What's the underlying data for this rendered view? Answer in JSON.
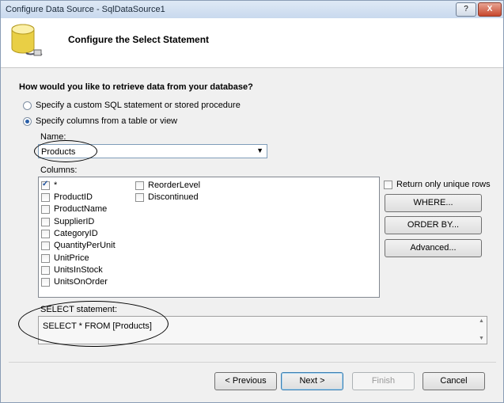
{
  "window": {
    "title": "Configure Data Source - SqlDataSource1",
    "help_label": "?",
    "close_label": "X"
  },
  "header": {
    "title": "Configure the Select Statement"
  },
  "retrieve": {
    "question": "How would you like to retrieve data from your database?",
    "option_custom": "Specify a custom SQL statement or stored procedure",
    "option_columns": "Specify columns from a table or view",
    "selected": "option_columns"
  },
  "name": {
    "label": "Name:",
    "value": "Products"
  },
  "columns": {
    "label": "Columns:",
    "items": [
      {
        "label": "*",
        "checked": true
      },
      {
        "label": "ProductID",
        "checked": false
      },
      {
        "label": "ProductName",
        "checked": false
      },
      {
        "label": "SupplierID",
        "checked": false
      },
      {
        "label": "CategoryID",
        "checked": false
      },
      {
        "label": "QuantityPerUnit",
        "checked": false
      },
      {
        "label": "UnitPrice",
        "checked": false
      },
      {
        "label": "UnitsInStock",
        "checked": false
      },
      {
        "label": "UnitsOnOrder",
        "checked": false
      },
      {
        "label": "ReorderLevel",
        "checked": false
      },
      {
        "label": "Discontinued",
        "checked": false
      }
    ]
  },
  "options": {
    "unique_rows_label": "Return only unique rows",
    "unique_rows_checked": false,
    "where_label": "WHERE...",
    "orderby_label": "ORDER BY...",
    "advanced_label": "Advanced..."
  },
  "sql": {
    "label": "SELECT statement:",
    "value": "SELECT * FROM [Products]"
  },
  "footer": {
    "previous_label": "< Previous",
    "next_label": "Next >",
    "finish_label": "Finish",
    "cancel_label": "Cancel"
  }
}
